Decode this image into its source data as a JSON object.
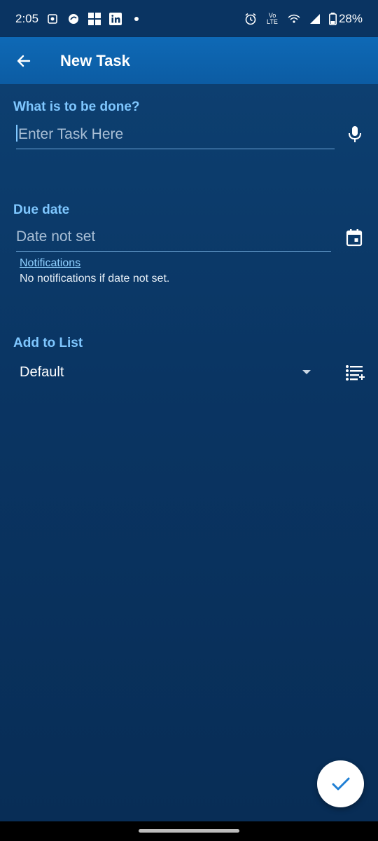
{
  "status_bar": {
    "time": "2:05",
    "icons_left": [
      "notification-icon",
      "vpn-icon",
      "app-icon",
      "linkedin-icon",
      "dot-icon"
    ],
    "icons_right": [
      "alarm-icon",
      "volte-icon",
      "wifi-icon",
      "signal-icon",
      "battery-icon"
    ],
    "volte_label": "Vo LTE",
    "battery": "28%"
  },
  "app_bar": {
    "title": "New Task"
  },
  "task": {
    "label": "What is to be done?",
    "placeholder": "Enter Task Here"
  },
  "due": {
    "label": "Due date",
    "value": "Date not set",
    "notifications_link": "Notifications",
    "notifications_hint": "No notifications if date not set."
  },
  "list": {
    "label": "Add to List",
    "selected": "Default"
  },
  "colors": {
    "accent": "#7fc7ff",
    "app_bar": "#0e69b6",
    "background": "#0a3563",
    "fab_check": "#1f7fd4"
  }
}
